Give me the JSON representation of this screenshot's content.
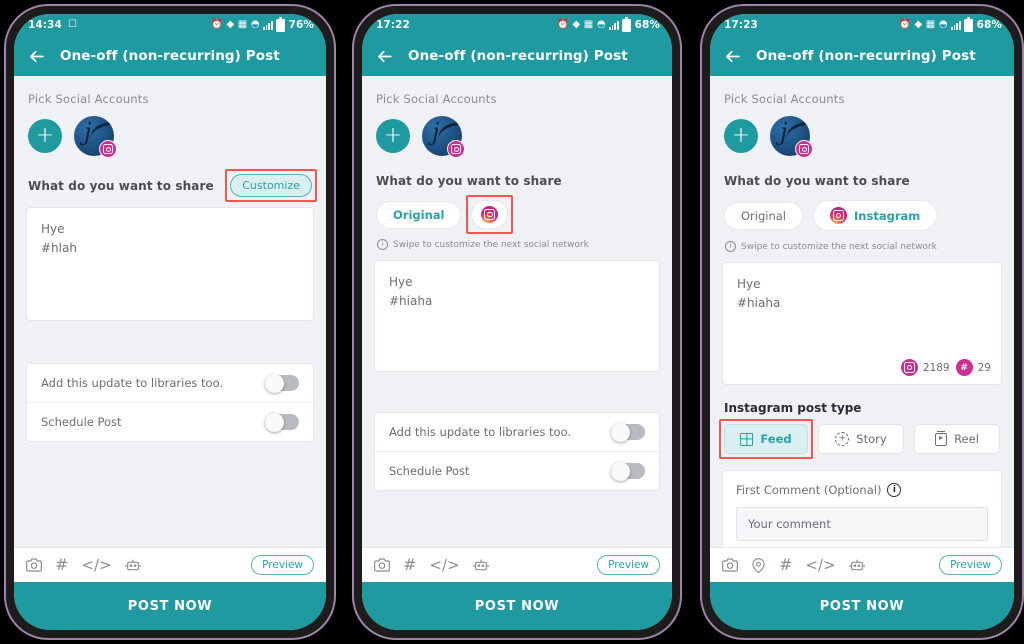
{
  "phones": [
    {
      "id": "phone-1",
      "status": {
        "time": "14:34",
        "battery": "76%",
        "icons": [
          "alarm-icon",
          "vibrate-icon",
          "nfc-icon",
          "wifi-icon",
          "signal-icon",
          "battery-icon"
        ]
      },
      "appbar": {
        "title": "One-off (non-recurring) Post",
        "back": "back-arrow-icon"
      },
      "pick_accounts_label": "Pick Social Accounts",
      "add_account_label": "+",
      "share_label": "What do you want to share",
      "customize_label": "Customize",
      "compose_text": "Hye\n#hlah",
      "toggles": [
        {
          "label": "Add this update to libraries too.",
          "on": false
        },
        {
          "label": "Schedule Post",
          "on": false
        }
      ],
      "toolbar_icons": [
        "camera-icon",
        "hashtag-icon",
        "code-icon",
        "robot-icon"
      ],
      "preview_label": "Preview",
      "post_now_label": "POST NOW"
    },
    {
      "id": "phone-2",
      "status": {
        "time": "17:22",
        "battery": "68%",
        "icons": [
          "alarm-icon",
          "vibrate-icon",
          "nfc-icon",
          "wifi-icon",
          "signal-icon",
          "battery-icon"
        ]
      },
      "appbar": {
        "title": "One-off (non-recurring) Post",
        "back": "back-arrow-icon"
      },
      "pick_accounts_label": "Pick Social Accounts",
      "add_account_label": "+",
      "share_label": "What do you want to share",
      "chips": [
        {
          "label": "Original",
          "type": "text",
          "active": true
        },
        {
          "label": "",
          "type": "instagram-icon",
          "active": false,
          "highlighted": true
        }
      ],
      "swipe_hint": "Swipe to customize the next social network",
      "compose_text": "Hye\n#hiaha",
      "toggles": [
        {
          "label": "Add this update to libraries too.",
          "on": false
        },
        {
          "label": "Schedule Post",
          "on": false
        }
      ],
      "toolbar_icons": [
        "camera-icon",
        "hashtag-icon",
        "code-icon",
        "robot-icon"
      ],
      "preview_label": "Preview",
      "post_now_label": "POST NOW"
    },
    {
      "id": "phone-3",
      "status": {
        "time": "17:23",
        "battery": "68%",
        "icons": [
          "alarm-icon",
          "vibrate-icon",
          "nfc-icon",
          "wifi-icon",
          "signal-icon",
          "battery-icon"
        ]
      },
      "appbar": {
        "title": "One-off (non-recurring) Post",
        "back": "back-arrow-icon"
      },
      "pick_accounts_label": "Pick Social Accounts",
      "add_account_label": "+",
      "share_label": "What do you want to share",
      "chips": [
        {
          "label": "Original",
          "type": "text",
          "active": false
        },
        {
          "label": "Instagram",
          "type": "instagram-icon",
          "active": true
        }
      ],
      "swipe_hint": "Swipe to customize the next social network",
      "compose_text": "Hye\n#hiaha",
      "counters": [
        {
          "icon": "instagram-icon",
          "value": "2189"
        },
        {
          "icon": "hashtag-icon",
          "value": "29"
        }
      ],
      "post_type_title": "Instagram post type",
      "post_types": [
        {
          "label": "Feed",
          "icon": "grid-icon",
          "active": true,
          "highlighted": true
        },
        {
          "label": "Story",
          "icon": "story-plus-icon",
          "active": false
        },
        {
          "label": "Reel",
          "icon": "reel-icon",
          "active": false
        }
      ],
      "first_comment_label": "First Comment (Optional)",
      "first_comment_info": "i",
      "first_comment_placeholder": "Your comment",
      "toolbar_icons": [
        "camera-icon",
        "location-pin-icon",
        "hashtag-icon",
        "code-icon",
        "robot-icon"
      ],
      "preview_label": "Preview",
      "post_now_label": "POST NOW"
    }
  ],
  "colors": {
    "teal": "#1e9aa0",
    "teal_light": "#d9eff0",
    "teal_text": "#2aa2a8",
    "magenta": "#cf2e92",
    "highlight_red": "#f4564e",
    "screen_bg": "#eff1f5",
    "page_bg": "#000000",
    "frame": "#9f82a8"
  }
}
